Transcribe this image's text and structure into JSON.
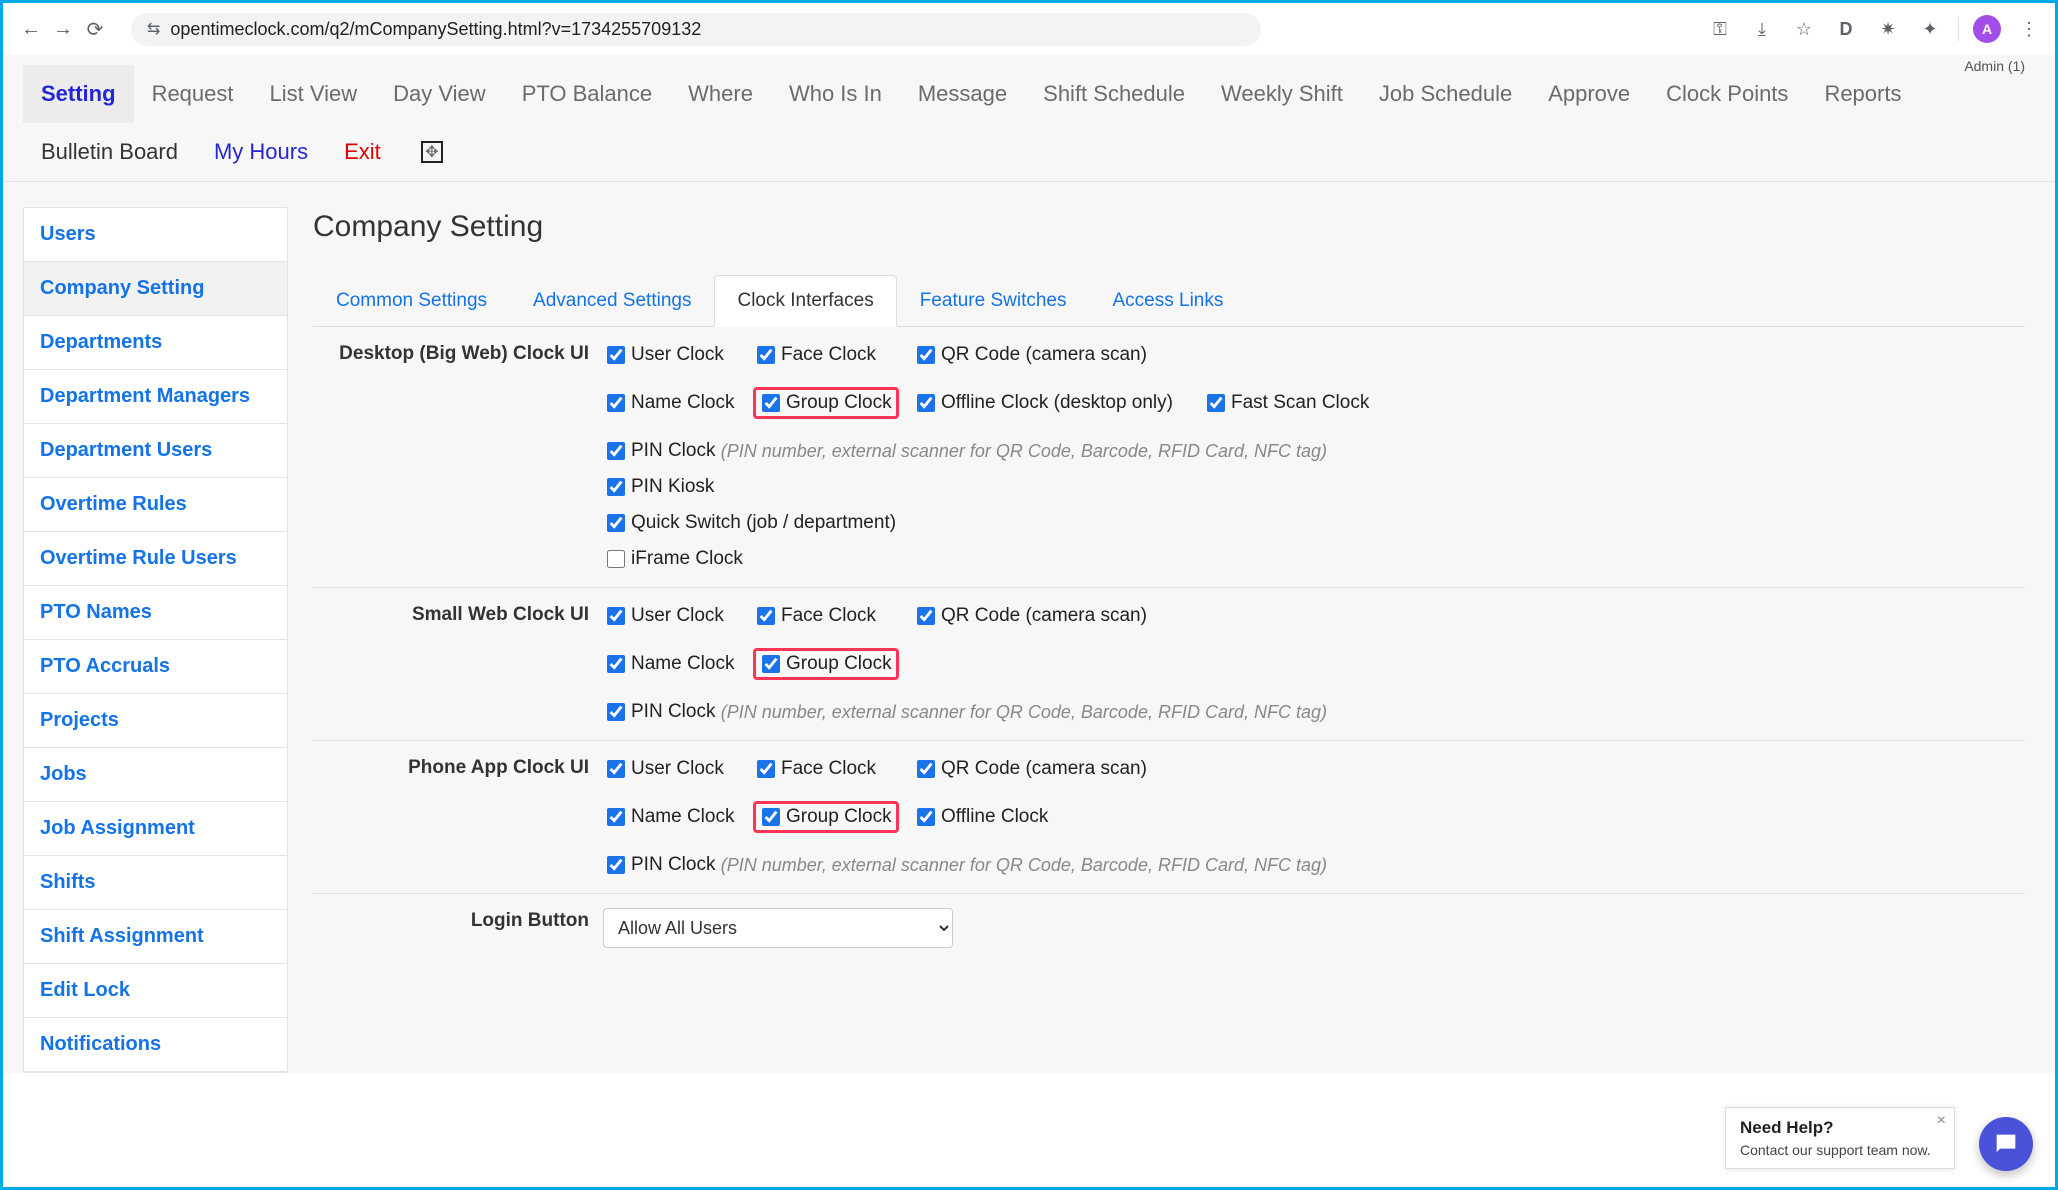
{
  "browser": {
    "url": "opentimeclock.com/q2/mCompanySetting.html?v=1734255709132",
    "avatar_letter": "A",
    "ext_d": "D"
  },
  "header": {
    "admin_label": "Admin (1)"
  },
  "top_nav": {
    "items": [
      "Setting",
      "Request",
      "List View",
      "Day View",
      "PTO Balance",
      "Where",
      "Who Is In",
      "Message",
      "Shift Schedule",
      "Weekly Shift",
      "Job Schedule",
      "Approve",
      "Clock Points",
      "Reports"
    ],
    "row2": {
      "bulletin": "Bulletin Board",
      "myhours": "My Hours",
      "exit": "Exit"
    }
  },
  "sidebar": {
    "items": [
      "Users",
      "Company Setting",
      "Departments",
      "Department Managers",
      "Department Users",
      "Overtime Rules",
      "Overtime Rule Users",
      "PTO Names",
      "PTO Accruals",
      "Projects",
      "Jobs",
      "Job Assignment",
      "Shifts",
      "Shift Assignment",
      "Edit Lock",
      "Notifications"
    ]
  },
  "page": {
    "title": "Company Setting",
    "tabs": [
      "Common Settings",
      "Advanced Settings",
      "Clock Interfaces",
      "Feature Switches",
      "Access Links"
    ]
  },
  "sections": {
    "desktop": {
      "label": "Desktop (Big Web) Clock UI",
      "user": "User Clock",
      "face": "Face Clock",
      "qr": "QR Code (camera scan)",
      "name": "Name Clock",
      "group": "Group Clock",
      "offline": "Offline Clock (desktop only)",
      "fast": "Fast Scan Clock",
      "pin": "PIN Clock",
      "pin_hint": "(PIN number, external scanner for QR Code, Barcode, RFID Card, NFC tag)",
      "kiosk": "PIN Kiosk",
      "quick": "Quick Switch (job / department)",
      "iframe": "iFrame Clock"
    },
    "smallweb": {
      "label": "Small Web Clock UI",
      "user": "User Clock",
      "face": "Face Clock",
      "qr": "QR Code (camera scan)",
      "name": "Name Clock",
      "group": "Group Clock",
      "pin": "PIN Clock",
      "pin_hint": "(PIN number, external scanner for QR Code, Barcode, RFID Card, NFC tag)"
    },
    "phone": {
      "label": "Phone App Clock UI",
      "user": "User Clock",
      "face": "Face Clock",
      "qr": "QR Code (camera scan)",
      "name": "Name Clock",
      "group": "Group Clock",
      "offline": "Offline Clock",
      "pin": "PIN Clock",
      "pin_hint": "(PIN number, external scanner for QR Code, Barcode, RFID Card, NFC tag)"
    },
    "login": {
      "label": "Login Button",
      "value": "Allow All Users"
    }
  },
  "chat": {
    "title": "Need Help?",
    "sub": "Contact our support team now."
  }
}
